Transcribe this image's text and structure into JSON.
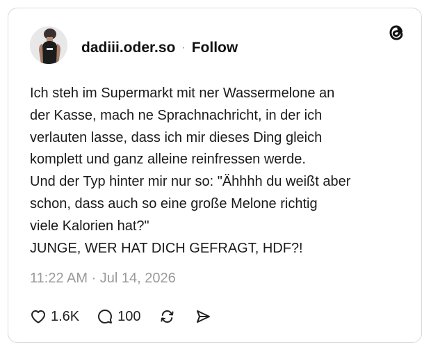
{
  "post": {
    "username": "dadiii.oder.so",
    "separator": "·",
    "follow_label": "Follow",
    "avatar_icon": "profile-photo",
    "app_logo_icon": "threads-logo-icon",
    "text_lines": [
      "Ich steh im Supermarkt mit ner Wassermelone an",
      "der Kasse, mach ne Sprachnachricht, in der ich",
      "verlauten lasse, dass ich mir dieses Ding gleich",
      "komplett und ganz alleine reinfressen werde.",
      "Und der Typ hinter mir nur so: \"Ähhhh du weißt aber",
      "schon, dass auch so eine große Melone richtig",
      "viele Kalorien hat?\"",
      "JUNGE, WER HAT DICH GEFRAGT, HDF?!"
    ],
    "timestamp": "11:22 AM · Jul 14, 2026"
  },
  "actions": {
    "like": {
      "icon": "heart-icon",
      "count": "1.6K"
    },
    "reply": {
      "icon": "comment-icon",
      "count": "100"
    },
    "repost": {
      "icon": "repost-icon"
    },
    "share": {
      "icon": "send-icon"
    }
  },
  "colors": {
    "text": "#1a1a1a",
    "muted": "#9a9a9a",
    "border": "#d9d9d9"
  }
}
